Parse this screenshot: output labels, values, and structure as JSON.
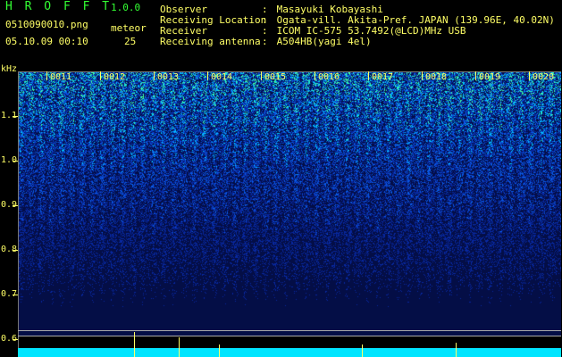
{
  "header": {
    "app_title": "H R O F F T",
    "app_version": "1.0.0",
    "filename": "0510090010.png",
    "datetime": "05.10.09 00:10",
    "meteor_label": "meteor",
    "meteor_count": "25",
    "info": [
      {
        "key": "Observer",
        "value": "Masayuki Kobayashi"
      },
      {
        "key": "Receiving Location",
        "value": "Ogata-vill. Akita-Pref. JAPAN (139.96E, 40.02N)"
      },
      {
        "key": "Receiver",
        "value": "ICOM IC-575 53.7492(@LCD)MHz USB"
      },
      {
        "key": "Receiving antenna",
        "value": "A504HB(yagi 4el)"
      }
    ]
  },
  "axis": {
    "unit": "kHz",
    "y_labels": [
      "1.1",
      "1.0",
      "0.9",
      "0.8",
      "0.7",
      "0.6"
    ],
    "x_labels": [
      "0011",
      "0012",
      "0013",
      "0014",
      "0015",
      "0016",
      "0017",
      "0018",
      "0019",
      "0020"
    ]
  },
  "colors": {
    "label": "#ffff66",
    "title": "#33ff33",
    "signal_high": "#00e5ff",
    "background_noise": "#0a1a5a"
  }
}
